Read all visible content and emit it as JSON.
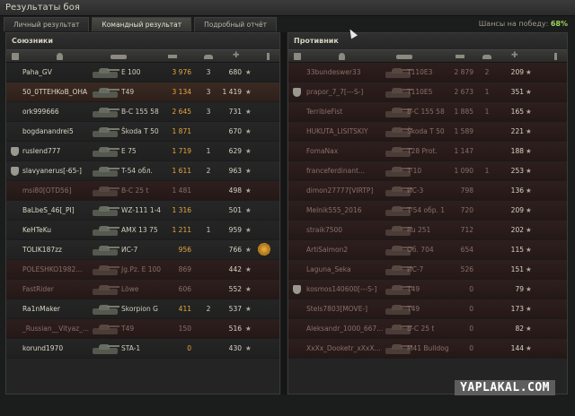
{
  "window": {
    "title": "Результаты боя"
  },
  "tabs": [
    {
      "label": "Личный результат",
      "active": false
    },
    {
      "label": "Командный результат",
      "active": true
    },
    {
      "label": "Подробный отчёт",
      "active": false
    }
  ],
  "win_chance": {
    "label": "Шансы на победу:",
    "value": "68%"
  },
  "allies": {
    "title": "Союзники",
    "rows": [
      {
        "name": "Paha_GV",
        "vehicle": "E 100",
        "damage": "3 976",
        "kills": "3",
        "xp": "680",
        "state": "alive",
        "clan": false,
        "medal": false
      },
      {
        "name": "50_0TTEHKoB_OHA",
        "vehicle": "T49",
        "damage": "3 134",
        "kills": "3",
        "xp": "1 419",
        "state": "self",
        "clan": false,
        "medal": false
      },
      {
        "name": "ork999666",
        "vehicle": "В-С 155 58",
        "damage": "2 645",
        "kills": "3",
        "xp": "731",
        "state": "alive",
        "clan": false,
        "medal": false
      },
      {
        "name": "bogdanandrei5",
        "vehicle": "Škoda T 50",
        "damage": "1 871",
        "kills": "",
        "xp": "670",
        "state": "alive",
        "clan": false,
        "medal": false
      },
      {
        "name": "ruslend777",
        "vehicle": "E 75",
        "damage": "1 719",
        "kills": "1",
        "xp": "629",
        "state": "alive",
        "clan": true,
        "medal": false
      },
      {
        "name": "slavyanerus[-65-]",
        "vehicle": "T-54 обл.",
        "damage": "1 611",
        "kills": "2",
        "xp": "963",
        "state": "alive",
        "clan": true,
        "medal": false
      },
      {
        "name": "msi80[OTD56]",
        "vehicle": "В-С 25 t",
        "damage": "1 481",
        "kills": "",
        "xp": "498",
        "state": "dead",
        "clan": false,
        "medal": false
      },
      {
        "name": "BaLbeS_46[_PI]",
        "vehicle": "WZ-111 1-4",
        "damage": "1 316",
        "kills": "",
        "xp": "501",
        "state": "alive",
        "clan": false,
        "medal": false
      },
      {
        "name": "KeHTeKu",
        "vehicle": "AMX 13 75",
        "damage": "1 211",
        "kills": "1",
        "xp": "959",
        "state": "alive",
        "clan": false,
        "medal": false
      },
      {
        "name": "TOLIK187zz",
        "vehicle": "ИС-7",
        "damage": "956",
        "kills": "",
        "xp": "766",
        "state": "alive",
        "clan": false,
        "medal": true
      },
      {
        "name": "POLESHKO1982...",
        "vehicle": "Jg.Pz. E 100",
        "damage": "869",
        "kills": "",
        "xp": "442",
        "state": "dead",
        "clan": false,
        "medal": false
      },
      {
        "name": "FastRider",
        "vehicle": "Löwe",
        "damage": "606",
        "kills": "",
        "xp": "552",
        "state": "dead",
        "clan": false,
        "medal": false
      },
      {
        "name": "Ra1nMaker",
        "vehicle": "Skorpion G",
        "damage": "411",
        "kills": "2",
        "xp": "537",
        "state": "alive",
        "clan": false,
        "medal": false
      },
      {
        "name": "_Russian__Vityaz_...",
        "vehicle": "T49",
        "damage": "150",
        "kills": "",
        "xp": "516",
        "state": "dead",
        "clan": false,
        "medal": false
      },
      {
        "name": "korund1970",
        "vehicle": "STA-1",
        "damage": "0",
        "kills": "",
        "xp": "430",
        "state": "alive",
        "clan": false,
        "medal": false
      }
    ]
  },
  "enemies": {
    "title": "Противник",
    "rows": [
      {
        "name": "33bundeswer33",
        "vehicle": "T110E3",
        "damage": "2 879",
        "kills": "2",
        "xp": "209",
        "state": "dead",
        "clan": false
      },
      {
        "name": "prapor_7_7[---S-]",
        "vehicle": "T110E5",
        "damage": "2 673",
        "kills": "1",
        "xp": "351",
        "state": "dead",
        "clan": true
      },
      {
        "name": "TerribleFist",
        "vehicle": "В-С 155 58",
        "damage": "1 885",
        "kills": "1",
        "xp": "165",
        "state": "dead",
        "clan": false
      },
      {
        "name": "HUKUTA_LISITSKIY",
        "vehicle": "Škoda T 50",
        "damage": "1 589",
        "kills": "",
        "xp": "221",
        "state": "dead",
        "clan": false
      },
      {
        "name": "FomaNax",
        "vehicle": "T28 Prot.",
        "damage": "1 147",
        "kills": "",
        "xp": "188",
        "state": "dead",
        "clan": false
      },
      {
        "name": "franceferdinant...",
        "vehicle": "T-10",
        "damage": "1 090",
        "kills": "1",
        "xp": "253",
        "state": "dead",
        "clan": false
      },
      {
        "name": "dimon27777[VIRTP]",
        "vehicle": "ИС-3",
        "damage": "798",
        "kills": "",
        "xp": "136",
        "state": "dead",
        "clan": false
      },
      {
        "name": "Melnik555_2016",
        "vehicle": "T-54 обр. 1",
        "damage": "720",
        "kills": "",
        "xp": "209",
        "state": "dead",
        "clan": false
      },
      {
        "name": "straik7500",
        "vehicle": "Ru 251",
        "damage": "712",
        "kills": "",
        "xp": "202",
        "state": "dead",
        "clan": false
      },
      {
        "name": "ArtiSaimon2",
        "vehicle": "Об. 704",
        "damage": "654",
        "kills": "",
        "xp": "115",
        "state": "dead",
        "clan": false
      },
      {
        "name": "Laguna_Seka",
        "vehicle": "ИС-7",
        "damage": "526",
        "kills": "",
        "xp": "151",
        "state": "dead",
        "clan": false
      },
      {
        "name": "kosmos140600[---S-]",
        "vehicle": "T49",
        "damage": "0",
        "kills": "",
        "xp": "79",
        "state": "dead",
        "clan": true
      },
      {
        "name": "Stels7803[MOVE-]",
        "vehicle": "T49",
        "damage": "0",
        "kills": "",
        "xp": "173",
        "state": "dead",
        "clan": false
      },
      {
        "name": "Aleksandr_1000_667...",
        "vehicle": "В-С 25 t",
        "damage": "0",
        "kills": "",
        "xp": "82",
        "state": "dead",
        "clan": false
      },
      {
        "name": "XxXx_Dooketr_xXxX...",
        "vehicle": "M41 Bulldog",
        "damage": "0",
        "kills": "",
        "xp": "144",
        "state": "dead",
        "clan": false
      }
    ]
  },
  "watermark": {
    "text": "YAPLAKAL.COM"
  },
  "colors": {
    "accent_green": "#9bd45d",
    "damage_orange": "#e8a640",
    "dead_red": "#8a6e69"
  },
  "icons": {
    "star": "★"
  }
}
